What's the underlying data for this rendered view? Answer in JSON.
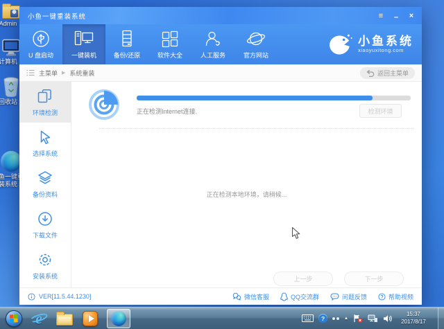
{
  "colors": {
    "primary_blue": "#3d8fe8",
    "header_blue": "#4292f0",
    "active_tab_blue": "#3a70c8"
  },
  "desktop": {
    "icons": [
      {
        "name": "admin-folder",
        "label": "Admin"
      },
      {
        "name": "computer",
        "label": "计算机"
      },
      {
        "name": "recycle-bin",
        "label": "回收站"
      },
      {
        "name": "xiaoyu-shortcut",
        "label": "小鱼一键重装系统"
      }
    ]
  },
  "window": {
    "title": "小鱼一键重装系统",
    "controls": {
      "menu": "≡",
      "minimize": "–",
      "close": "×"
    },
    "nav": {
      "items": [
        {
          "label": "U 盘启动",
          "icon": "usb-icon",
          "active": false
        },
        {
          "label": "一键装机",
          "icon": "computer-icon",
          "active": true
        },
        {
          "label": "备份/还原",
          "icon": "server-icon",
          "active": false
        },
        {
          "label": "软件大全",
          "icon": "apps-grid-icon",
          "active": false
        },
        {
          "label": "人工服务",
          "icon": "person-icon",
          "active": false
        },
        {
          "label": "官方网站",
          "icon": "globe-icon",
          "active": false
        }
      ],
      "logo": {
        "title": "小鱼系统",
        "subtitle": "xiaoyuxitong.com",
        "icon": "fish-icon"
      }
    },
    "breadcrumb": {
      "root": "主菜单",
      "separator": "▶",
      "current": "系统重装",
      "back_button": "返回主菜单"
    },
    "sidebar": {
      "items": [
        {
          "label": "环境检测",
          "icon": "env-detect-icon",
          "active": true
        },
        {
          "label": "选择系统",
          "icon": "cursor-select-icon",
          "active": false
        },
        {
          "label": "备份资料",
          "icon": "layers-icon",
          "active": false
        },
        {
          "label": "下载文件",
          "icon": "download-icon",
          "active": false
        },
        {
          "label": "安装系统",
          "icon": "gear-icon",
          "active": false
        }
      ]
    },
    "main": {
      "progress_percent": 86,
      "status_text": "正在检测Internet连接.",
      "detect_button": "检测环境",
      "waiting_text": "正在检测本地环境，请稍候...",
      "prev_button": "上一步",
      "next_button": "下一步"
    },
    "footer": {
      "version": "VER[11.5.44.1230]",
      "links": [
        {
          "label": "微信客服",
          "icon": "wechat-icon"
        },
        {
          "label": "QQ交流群",
          "icon": "qq-icon"
        },
        {
          "label": "问题反馈",
          "icon": "feedback-icon"
        },
        {
          "label": "帮助视频",
          "icon": "help-icon"
        }
      ]
    }
  },
  "taskbar": {
    "apps": [
      {
        "name": "start-button"
      },
      {
        "name": "internet-explorer"
      },
      {
        "name": "file-explorer"
      },
      {
        "name": "media-player"
      },
      {
        "name": "edge-browser",
        "active": true
      }
    ],
    "tray": {
      "help_glyph": "?",
      "caret_glyph": "▲",
      "clock": {
        "time": "15:37",
        "date": "2017/8/17"
      }
    }
  }
}
